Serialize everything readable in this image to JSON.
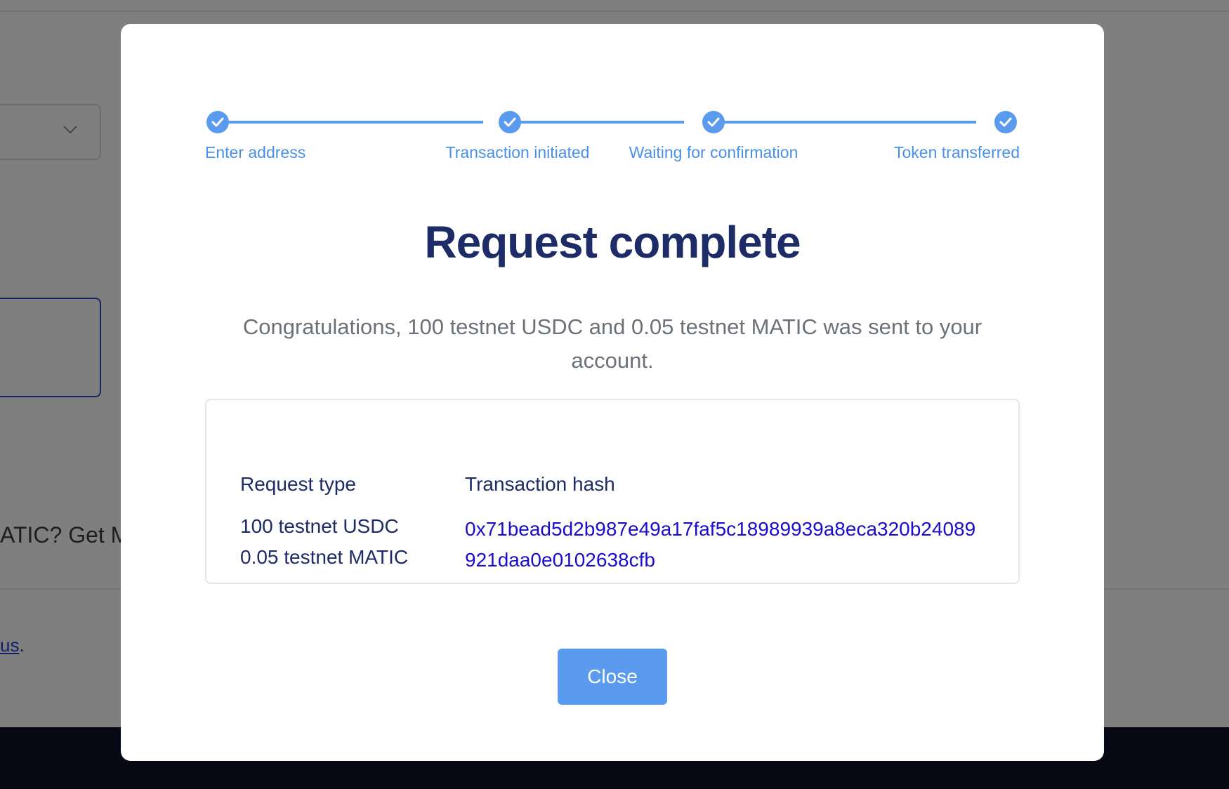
{
  "stepper": {
    "steps": [
      {
        "label": "Enter address"
      },
      {
        "label": "Transaction initiated"
      },
      {
        "label": "Waiting for confirmation"
      },
      {
        "label": "Token transferred"
      }
    ],
    "progress": 1.0
  },
  "modal": {
    "title": "Request complete",
    "message": "Congratulations, 100 testnet USDC and 0.05 testnet MATIC was sent to your account.",
    "details": {
      "col_request_type": "Request type",
      "col_tx_hash": "Transaction hash",
      "requests": [
        "100 testnet USDC",
        "0.05 testnet MATIC"
      ],
      "tx_hash": "0x71bead5d2b987e49a17faf5c18989939a8eca320b24089921daa0e0102638cfb"
    },
    "close_label": "Close"
  },
  "background": {
    "matic_text": "ATIC? Get M",
    "link_text": "us",
    "link_suffix": "."
  },
  "colors": {
    "accent": "#5b9bef",
    "title": "#1d2b66",
    "link": "#1a0dcc",
    "overlay": "rgba(0,0,0,0.5)",
    "footer": "#0c1027"
  }
}
